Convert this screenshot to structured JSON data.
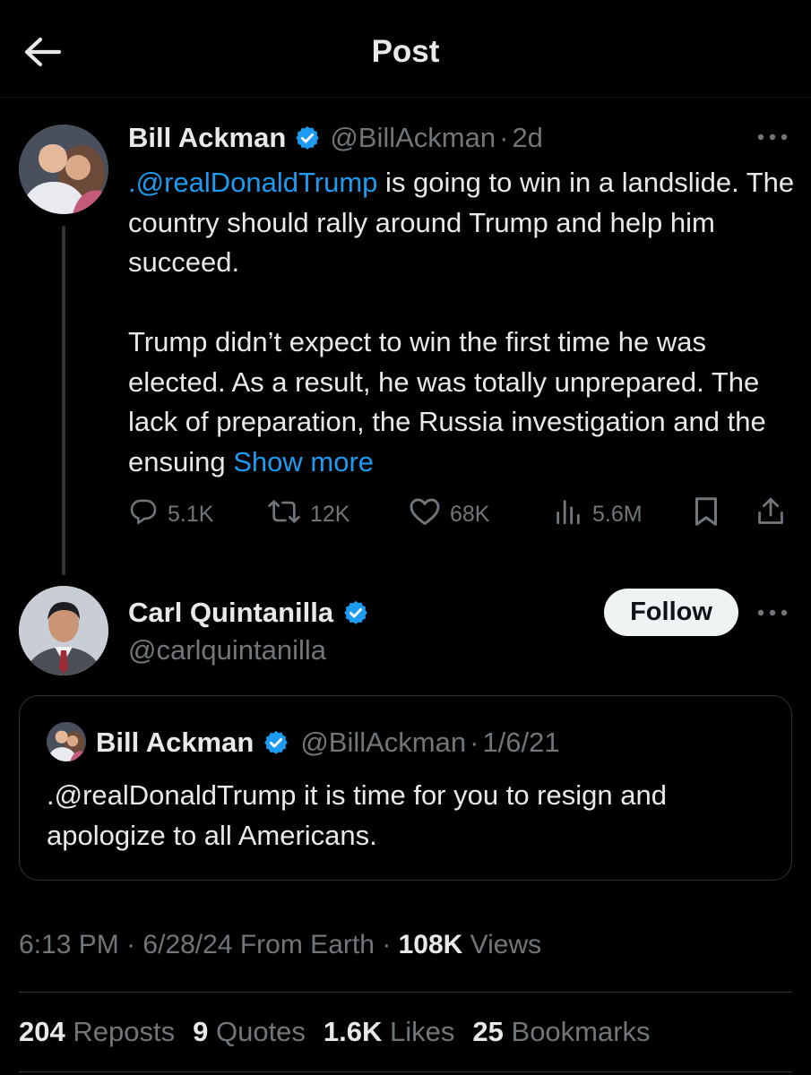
{
  "header": {
    "title": "Post"
  },
  "main_post": {
    "author_name": "Bill Ackman",
    "handle": "@BillAckman",
    "separator": "·",
    "time": "2d",
    "text_line1_mention": ".@realDonaldTrump",
    "text_line1_rest": " is going to win in a landslide. The country should rally around Trump and help him succeed.",
    "text_para2": "Trump didn’t expect  to win the first time he was elected. As a result, he was totally unprepared. The lack of preparation, the Russia investigation and the ensuing ",
    "show_more": "Show more",
    "replies": "5.1K",
    "reposts": "12K",
    "likes": "68K",
    "views": "5.6M",
    "icons": {
      "reply": "reply-icon",
      "repost": "repost-icon",
      "like": "heart-icon",
      "views": "views-icon",
      "bookmark": "bookmark-icon",
      "share": "share-icon"
    }
  },
  "reply_post": {
    "author_name": "Carl Quintanilla",
    "handle": "@carlquintanilla",
    "follow_label": "Follow"
  },
  "quoted_post": {
    "author_name": "Bill Ackman",
    "handle": "@BillAckman",
    "separator": "·",
    "time": "1/6/21",
    "text": ".@realDonaldTrump it is time for you to resign and apologize to all Americans."
  },
  "meta": {
    "time": "6:13 PM",
    "sep1": "·",
    "date": "6/28/24",
    "source": "From Earth",
    "sep2": "·",
    "views_count": "108K",
    "views_label": "Views"
  },
  "stats": [
    {
      "count": "204",
      "label": "Reposts"
    },
    {
      "count": "9",
      "label": "Quotes"
    },
    {
      "count": "1.6K",
      "label": "Likes"
    },
    {
      "count": "25",
      "label": "Bookmarks"
    }
  ],
  "colors": {
    "background": "#000000",
    "text": "#e7e9ea",
    "secondary": "#71767b",
    "link": "#1d9bf0",
    "verified": "#1d9bf0"
  }
}
